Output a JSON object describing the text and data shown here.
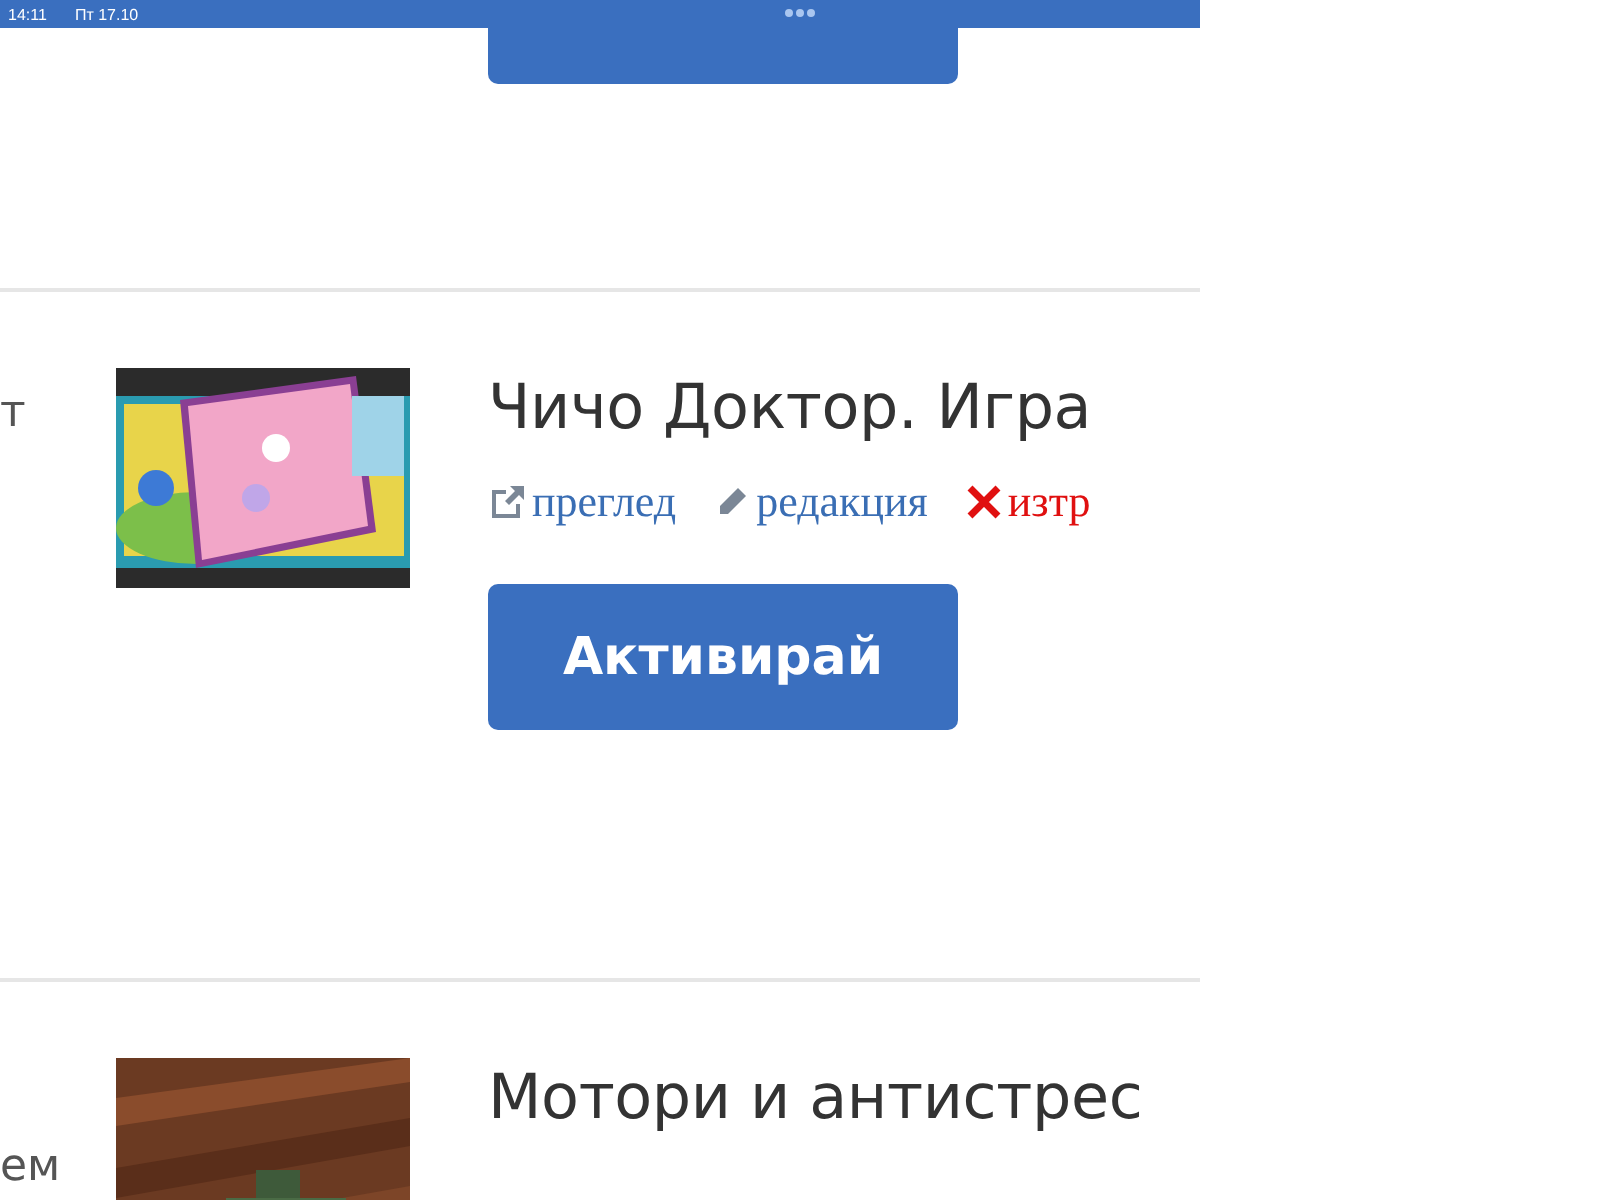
{
  "status_bar": {
    "time": "14:11",
    "date": "Пт 17.10"
  },
  "listings": [
    {
      "kind": "button_tail"
    },
    {
      "kind": "full",
      "side_text": "т",
      "title": "Чичо Доктор. Игра",
      "actions": [
        {
          "kind": "view",
          "label": "преглед"
        },
        {
          "kind": "edit",
          "label": "редакция"
        },
        {
          "kind": "delete",
          "label": "изтр"
        }
      ],
      "button": "Активирай"
    },
    {
      "kind": "full",
      "side_text": "ем",
      "title": "Мотори и антистрес"
    }
  ]
}
